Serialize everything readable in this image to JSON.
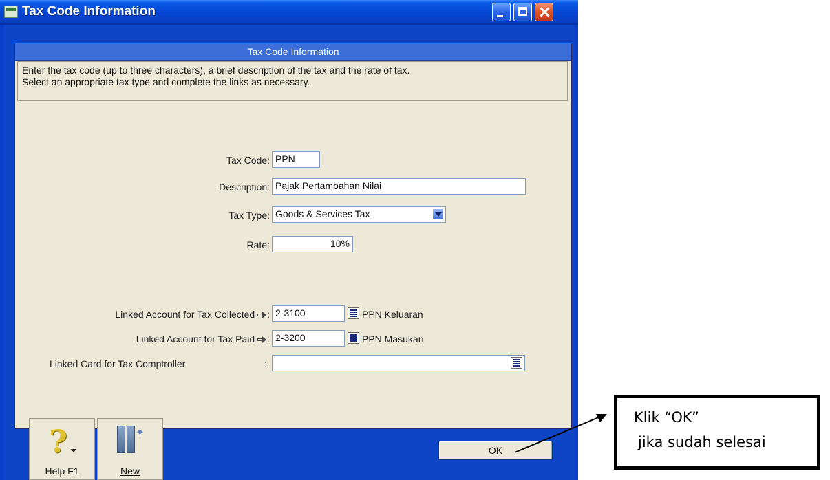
{
  "window": {
    "title": "Tax Code Information",
    "controls": [
      "minimize-icon",
      "maximize-icon",
      "close-icon"
    ]
  },
  "panel": {
    "header": "Tax Code Information",
    "instructions_line1": "Enter the tax code (up to three characters), a brief description of the tax and the rate of tax.",
    "instructions_line2": "Select an appropriate tax type and complete the links as necessary."
  },
  "form": {
    "tax_code_label": "Tax Code:",
    "tax_code_value": "PPN",
    "description_label": "Description:",
    "description_value": "Pajak Pertambahan Nilai",
    "tax_type_label": "Tax Type:",
    "tax_type_value": "Goods & Services Tax",
    "rate_label": "Rate:",
    "rate_value": "10%",
    "linked_collected_label": "Linked Account for Tax Collected",
    "linked_collected_sep": ":",
    "linked_collected_value": "2-3100",
    "linked_collected_name": "PPN Keluaran",
    "linked_paid_label": "Linked Account for Tax Paid",
    "linked_paid_sep": ":",
    "linked_paid_value": "2-3200",
    "linked_paid_name": "PPN Masukan",
    "linked_card_label": "Linked Card for Tax Comptroller",
    "linked_card_sep": ":",
    "linked_card_value": ""
  },
  "footer": {
    "help_label": "Help F1",
    "new_label": "New",
    "ok_label": "OK"
  },
  "annotation": {
    "line1": "Klik “OK”",
    "line2": "jika sudah selesai"
  }
}
